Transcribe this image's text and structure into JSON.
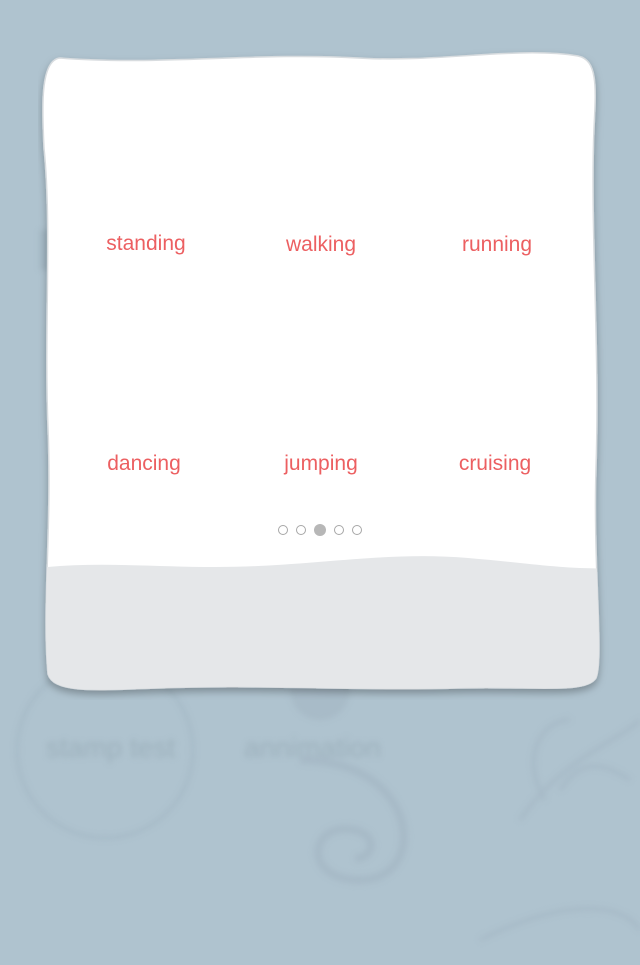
{
  "background": {
    "labels": [
      "stamp test",
      "annimation"
    ]
  },
  "gallery": {
    "items": [
      {
        "label": "standing"
      },
      {
        "label": "walking"
      },
      {
        "label": "running"
      },
      {
        "label": "dancing"
      },
      {
        "label": "jumping"
      },
      {
        "label": "cruising"
      }
    ],
    "pages": 5,
    "current_page": 3
  },
  "colors": {
    "background": "#afc3cf",
    "card": "#ffffff",
    "footer": "#e5e7e9",
    "accent": "#ec5f61",
    "indicator": "#b7b7b7"
  }
}
